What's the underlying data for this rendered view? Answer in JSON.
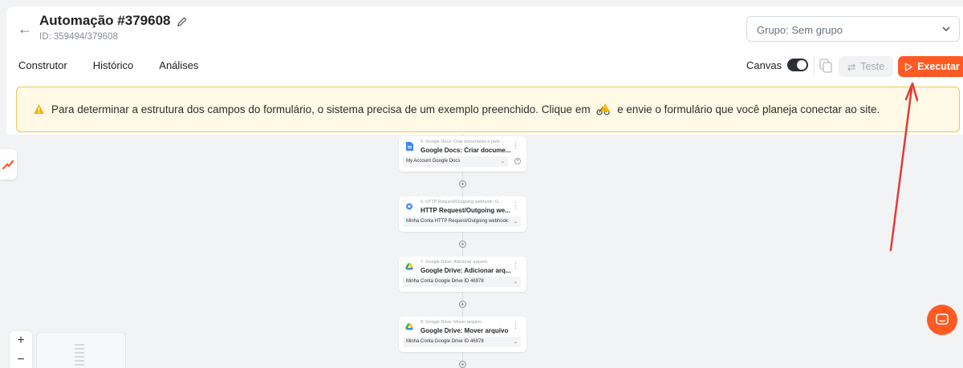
{
  "header": {
    "title": "Automação #379608",
    "id_label": "ID: 359494/379608",
    "group_select_value": "Grupo: Sem grupo"
  },
  "tabs": [
    "Construtor",
    "Histórico",
    "Análises"
  ],
  "toolbar": {
    "canvas_label": "Canvas",
    "canvas_enabled": true,
    "test_label": "Teste",
    "run_label": "Executar"
  },
  "banner": {
    "text_before": "Para determinar a estrutura dos campos do formulário, o sistema precisa de um exemplo preenchido. Clique em",
    "text_after": "e envie o formulário que você planeja conectar ao site."
  },
  "flow": {
    "cards": [
      {
        "subtitle": "5. Google Docs: Criar documento a parti...",
        "title": "Google Docs: Criar docume...",
        "account": "My Account Google Docs",
        "icon": "google-docs-icon"
      },
      {
        "subtitle": "6. HTTP Request/Outgoing webhook: O...",
        "title": "HTTP Request/Outgoing we...",
        "account": "Minha Conta HTTP Request/Outgoing webhook",
        "icon": "http-request-icon"
      },
      {
        "subtitle": "7. Google Drive: Adicionar arquivo",
        "title": "Google Drive: Adicionar arq...",
        "account": "Minha Conta Google Drive ID 46978",
        "icon": "google-drive-icon"
      },
      {
        "subtitle": "8. Google Drive: Mover arquivo",
        "title": "Google Drive: Mover arquivo",
        "account": "Minha Conta Google Drive ID 46978",
        "icon": "google-drive-icon"
      }
    ]
  },
  "zoom": {
    "in": "+",
    "out": "−"
  },
  "colors": {
    "accent": "#ff5a24",
    "banner_bg": "#fff9e6",
    "banner_border": "#f5c451",
    "annotation_arrow": "#e53935"
  }
}
